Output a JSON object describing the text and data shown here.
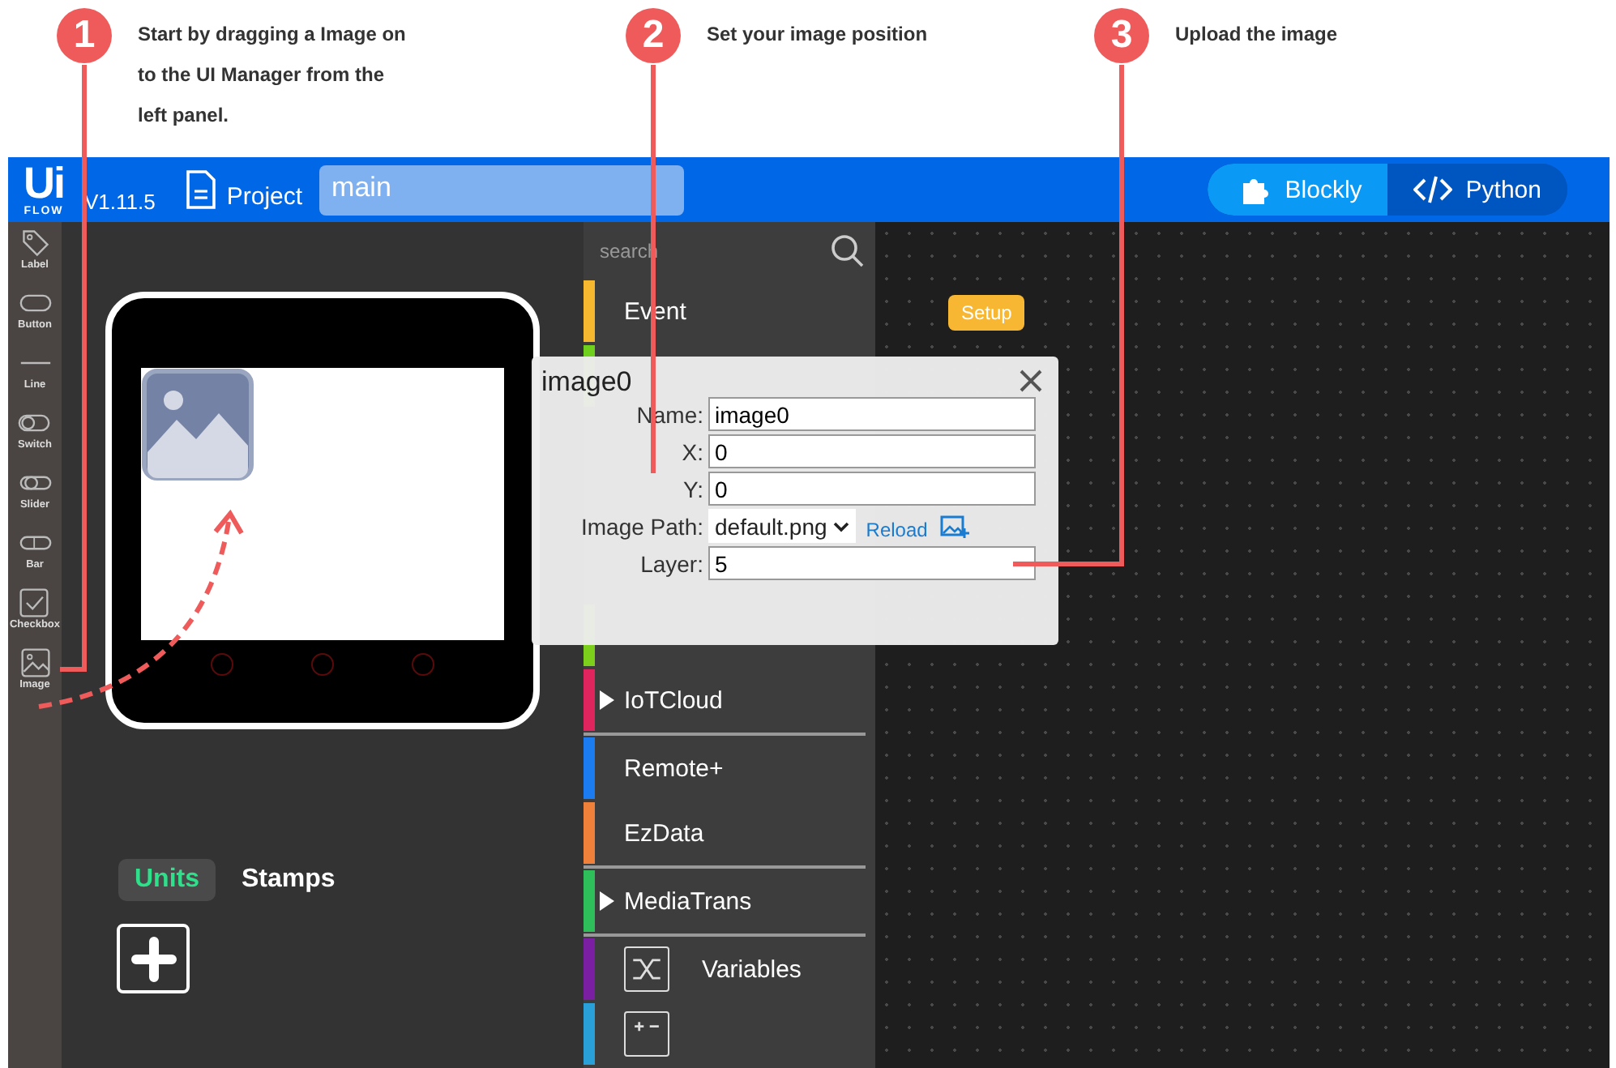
{
  "steps": [
    {
      "number": "1",
      "text": "Start by dragging a Image on to the UI Manager from the left panel."
    },
    {
      "number": "2",
      "text": "Set your image position"
    },
    {
      "number": "3",
      "text": "Upload the image"
    }
  ],
  "header": {
    "logo": "Ui",
    "logo_sub": "FLOW",
    "version": "V1.11.5",
    "project_label": "Project",
    "file_name": "main",
    "modes": [
      {
        "label": "Blockly",
        "kind": "blocks",
        "selected": true
      },
      {
        "label": "Python",
        "kind": "code",
        "selected": false
      }
    ]
  },
  "toolbox": [
    {
      "label": "Label",
      "kind": "label"
    },
    {
      "label": "Button",
      "kind": "button"
    },
    {
      "label": "Line",
      "kind": "line"
    },
    {
      "label": "Switch",
      "kind": "switch"
    },
    {
      "label": "Slider",
      "kind": "slider"
    },
    {
      "label": "Bar",
      "kind": "bar"
    },
    {
      "label": "Checkbox",
      "kind": "checkbox"
    },
    {
      "label": "Image",
      "kind": "image"
    }
  ],
  "panel_tabs": [
    {
      "label": "Units",
      "selected": true
    },
    {
      "label": "Stamps",
      "selected": false
    }
  ],
  "categories": {
    "search": {
      "placeholder": "search"
    },
    "groups": [
      [
        {
          "label": "Event",
          "color": "#f5b82e",
          "expandable": false
        },
        {
          "color": "#6fd11c"
        },
        {
          "kind": "covered"
        },
        {
          "kind": "covered"
        },
        {
          "kind": "covered"
        },
        {
          "color": "#7ccf1a"
        },
        {
          "label": "IoTCloud",
          "color": "#e0245e",
          "expandable": true
        }
      ],
      [
        {
          "label": "Remote+",
          "color": "#1a7cf0",
          "expandable": false
        },
        {
          "label": "EzData",
          "color": "#f0813a",
          "expandable": false
        }
      ],
      [
        {
          "label": "MediaTrans",
          "color": "#2fbf5a",
          "expandable": true
        }
      ],
      [
        {
          "label": "Variables",
          "color": "#7b1fa2",
          "expandable": false,
          "kind": "variables"
        },
        {
          "color": "#2aa0d8",
          "kind": "math"
        }
      ]
    ]
  },
  "workspace": {
    "block": "Setup"
  },
  "dialog": {
    "title": "image0",
    "fields": [
      {
        "label": "Name:",
        "kind": "text",
        "value": "image0"
      },
      {
        "label": "X:",
        "kind": "text",
        "value": "0"
      },
      {
        "label": "Y:",
        "kind": "text",
        "value": "0"
      },
      {
        "label": "Image Path:",
        "kind": "select",
        "value": "default.png",
        "link": "Reload"
      },
      {
        "label": "Layer:",
        "kind": "text",
        "value": "5"
      }
    ]
  }
}
